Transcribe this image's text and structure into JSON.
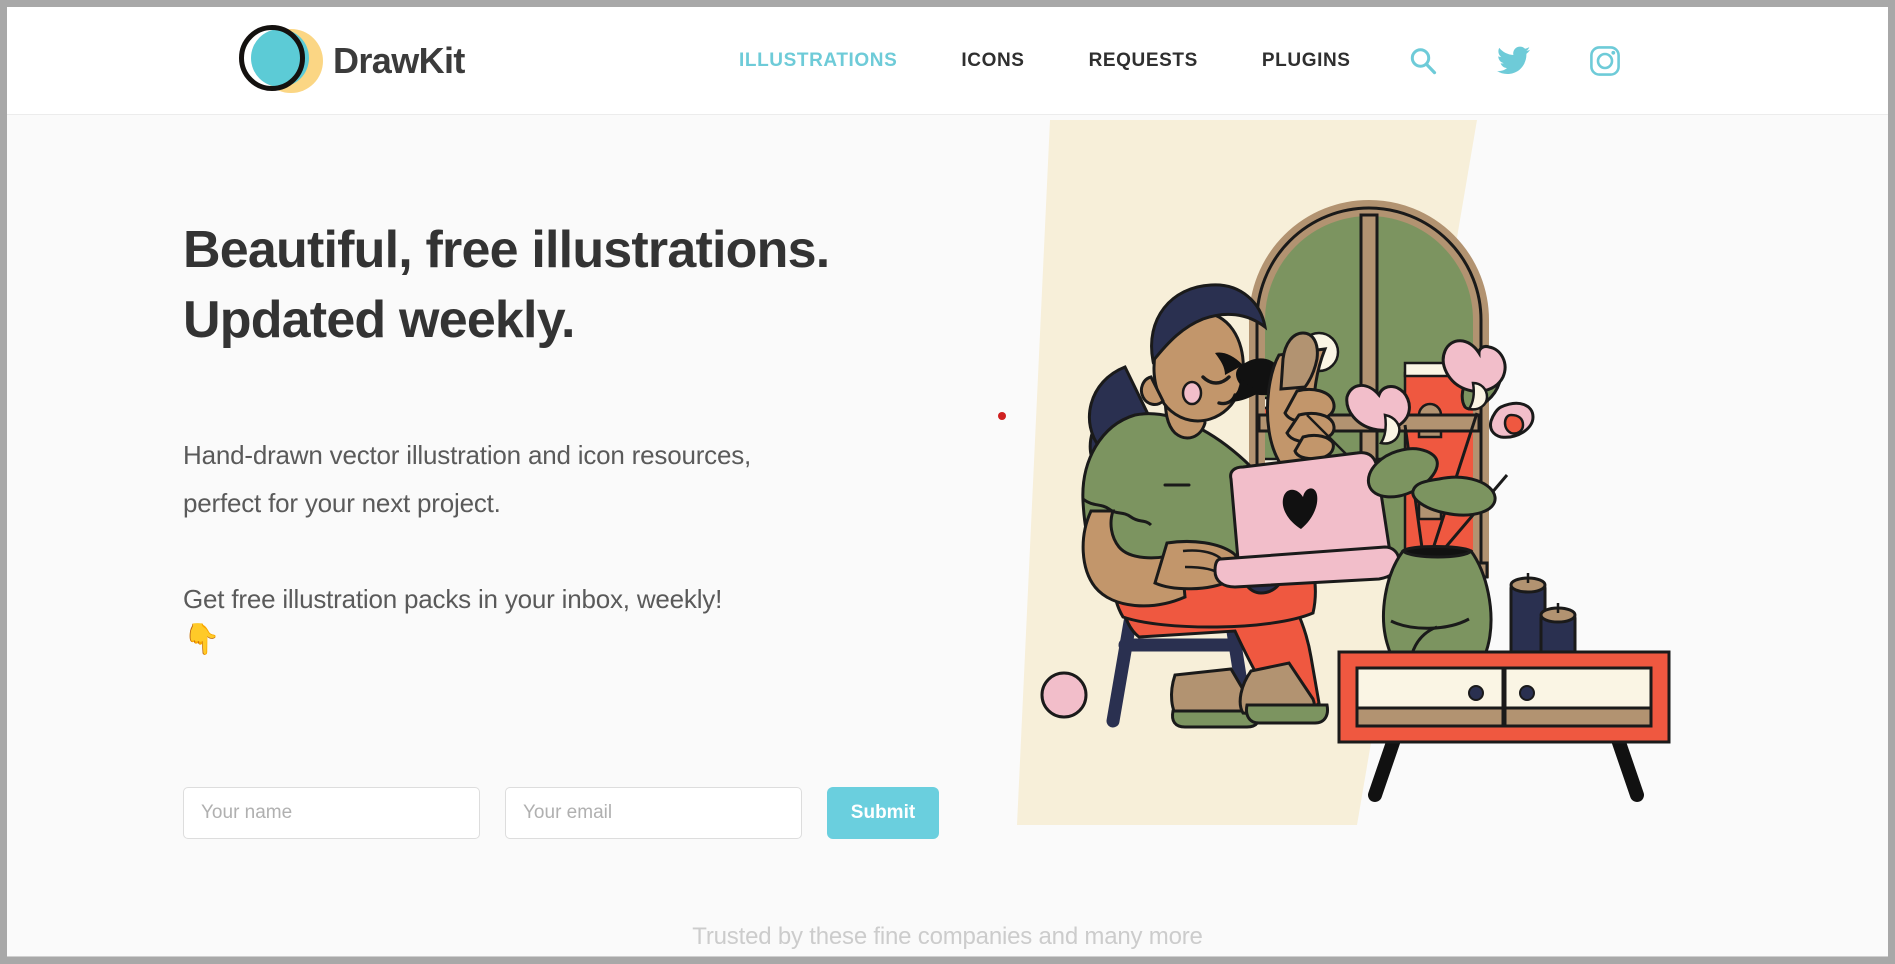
{
  "brand": {
    "name": "DrawKit",
    "logo_icon": "drawkit-circles-logo",
    "accent_color": "#6ACFDE",
    "yellow_color": "#FBD684"
  },
  "nav": {
    "links": [
      {
        "label": "ILLUSTRATIONS",
        "active": true
      },
      {
        "label": "ICONS",
        "active": false
      },
      {
        "label": "REQUESTS",
        "active": false
      },
      {
        "label": "PLUGINS",
        "active": false
      }
    ],
    "icons": [
      {
        "name": "search-icon",
        "label": "Search"
      },
      {
        "name": "twitter-icon",
        "label": "Twitter"
      },
      {
        "name": "instagram-icon",
        "label": "Instagram"
      }
    ]
  },
  "hero": {
    "headline_line1": "Beautiful, free illustrations.",
    "headline_line2": "Updated weekly.",
    "paragraph1": "Hand-drawn vector illustration and icon resources, perfect for your next project.",
    "paragraph2": "Get free illustration packs in your inbox, weekly!",
    "point_emoji": "👇",
    "form": {
      "name_placeholder": "Your name",
      "name_value": "",
      "email_placeholder": "Your email",
      "email_value": "",
      "submit_label": "Submit"
    },
    "illustration_name": "woman-on-stool-with-laptop-illustration"
  },
  "footer": {
    "trusted_text": "Trusted by these fine companies and many more"
  },
  "illustration_colors": {
    "backdrop": "#F7EFD9",
    "red": "#EF5840",
    "green": "#7C9460",
    "navy": "#2A3050",
    "pink": "#F2BECA",
    "tan": "#B29371",
    "skin": "#C2966B",
    "cream": "#FAF5E4",
    "outline": "#1A1A1A"
  }
}
